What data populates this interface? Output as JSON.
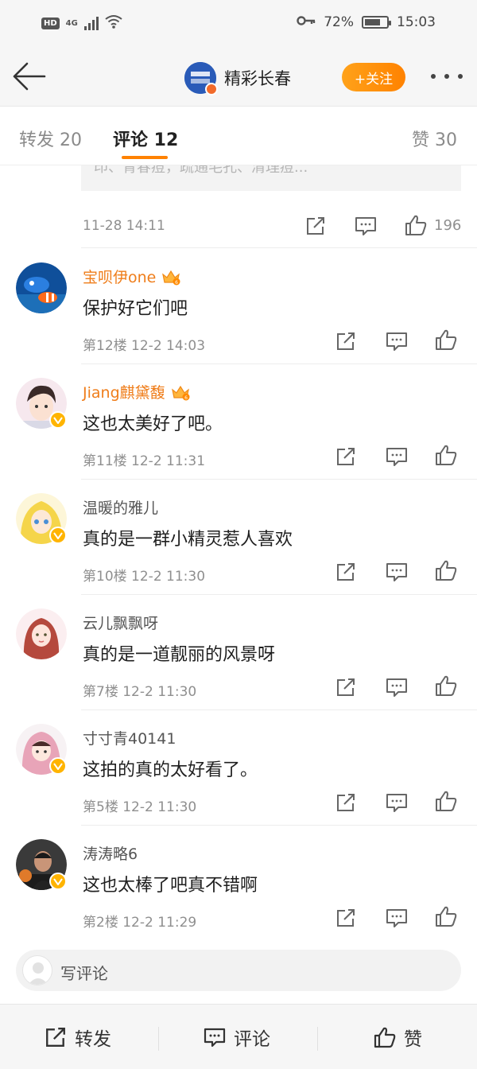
{
  "status_bar": {
    "hd": "HD",
    "network": "4G",
    "battery_percent": "72%",
    "battery_level": 0.72,
    "time": "15:03"
  },
  "nav": {
    "title": "精彩长春",
    "follow_label": "+关注"
  },
  "tabs": {
    "repost": "转发 20",
    "comments": "评论 12",
    "likes": "赞 30"
  },
  "quoted": {
    "text": "印、青春痘，疏通毛孔、清理痘..."
  },
  "post": {
    "time": "11-28 14:11",
    "like_count": "196"
  },
  "comments": [
    {
      "user": "宝呗伊one",
      "text": "保护好它们吧",
      "floor": "第12楼",
      "time": "12-2 14:03"
    },
    {
      "user": "Jiang麒黛馥",
      "text": "这也太美好了吧。",
      "floor": "第11楼",
      "time": "12-2 11:31"
    },
    {
      "user": "温暖的雅儿",
      "text": "真的是一群小精灵惹人喜欢",
      "floor": "第10楼",
      "time": "12-2 11:30"
    },
    {
      "user": "云儿飘飘呀",
      "text": "真的是一道靓丽的风景呀",
      "floor": "第7楼",
      "time": "12-2 11:30"
    },
    {
      "user": "寸寸青40141",
      "text": "这拍的真的太好看了。",
      "floor": "第5楼",
      "time": "12-2 11:30"
    },
    {
      "user": "涛涛略6",
      "text": "这也太棒了吧真不错啊",
      "floor": "第2楼",
      "time": "12-2 11:29"
    }
  ],
  "write_comment": {
    "placeholder": "写评论"
  },
  "bottom_bar": {
    "repost": "转发",
    "comment": "评论",
    "like": "赞"
  },
  "colors": {
    "accent": "#ff8200",
    "vip_name": "#ef7d1a"
  }
}
